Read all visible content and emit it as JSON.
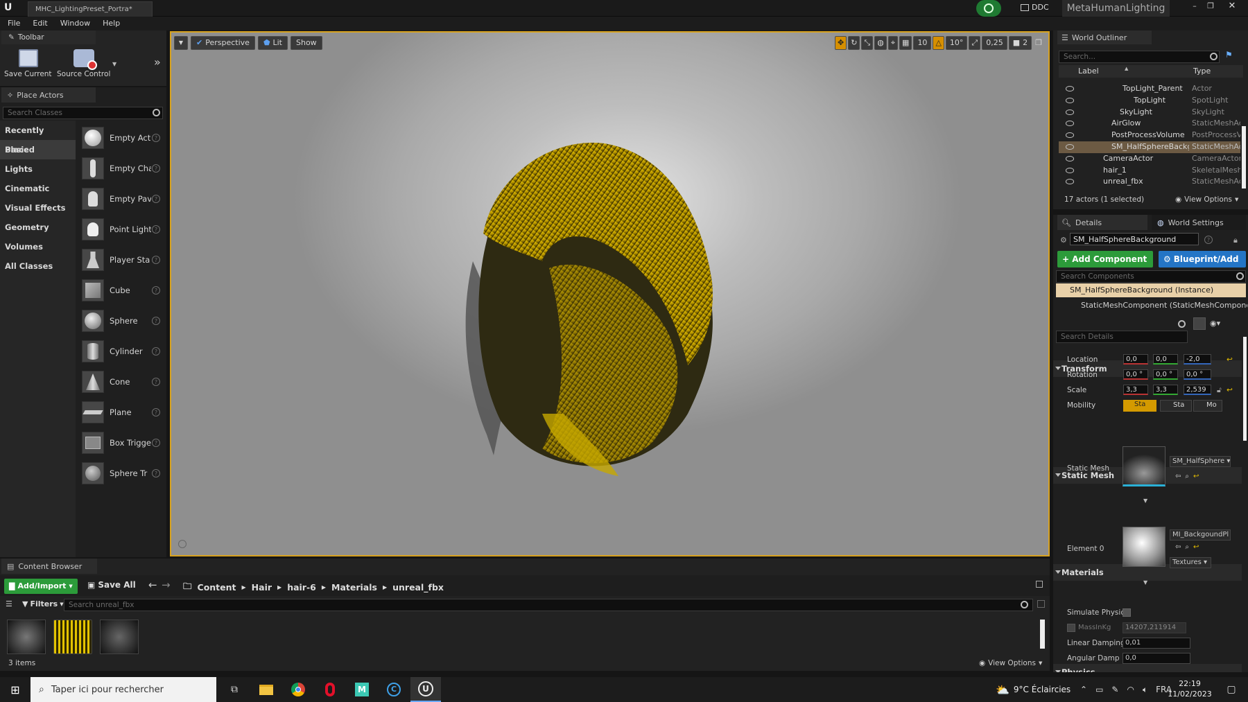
{
  "title_bar": {
    "tab": "MHC_LightingPreset_Portra*",
    "ddc": "DDC",
    "project": "MetaHumanLighting"
  },
  "menu": [
    "File",
    "Edit",
    "Window",
    "Help"
  ],
  "toolbar": {
    "title": "Toolbar",
    "save_current": "Save Current",
    "source_control": "Source Control"
  },
  "place_actors": {
    "title": "Place Actors",
    "search_placeholder": "Search Classes",
    "categories": [
      "Recently Placed",
      "Basic",
      "Lights",
      "Cinematic",
      "Visual Effects",
      "Geometry",
      "Volumes",
      "All Classes"
    ],
    "selected_category": "Basic",
    "items": [
      "Empty Act",
      "Empty Cha",
      "Empty Pav",
      "Point Light",
      "Player Sta",
      "Cube",
      "Sphere",
      "Cylinder",
      "Cone",
      "Plane",
      "Box Trigge",
      "Sphere Tr"
    ]
  },
  "viewport": {
    "perspective": "Perspective",
    "lit": "Lit",
    "show": "Show",
    "grid_snap": "10",
    "rot_snap": "10°",
    "scale_snap": "0,25",
    "cam_speed": "2"
  },
  "outliner": {
    "title": "World Outliner",
    "search_placeholder": "Search...",
    "col_label": "Label",
    "col_type": "Type",
    "rows": [
      {
        "name": "TopLight_Parent",
        "type": "Actor",
        "indent": 1
      },
      {
        "name": "TopLight",
        "type": "SpotLight",
        "indent": 2
      },
      {
        "name": "SkyLight",
        "type": "SkyLight",
        "indent": 1
      },
      {
        "name": "AirGlow",
        "type": "StaticMeshAc",
        "indent": 0
      },
      {
        "name": "PostProcessVolume",
        "type": "PostProcessV",
        "indent": 0
      },
      {
        "name": "SM_HalfSphereBackg",
        "type": "StaticMeshAc",
        "indent": 0,
        "selected": true
      },
      {
        "name": "CameraActor",
        "type": "CameraActor",
        "indent": -1
      },
      {
        "name": "hair_1",
        "type": "SkeletalMesh",
        "indent": -1
      },
      {
        "name": "unreal_fbx",
        "type": "StaticMeshAc",
        "indent": -1
      }
    ],
    "footer": "17 actors (1 selected)",
    "view_options": "View Options"
  },
  "details": {
    "tab_details": "Details",
    "tab_world": "World Settings",
    "object_name": "SM_HalfSphereBackground",
    "add_component": "+ Add Component",
    "blueprint": "Blueprint/Add",
    "search_components": "Search Components",
    "instance": "SM_HalfSphereBackground (Instance)",
    "component": "StaticMeshComponent (StaticMeshComponent",
    "search_details": "Search Details",
    "transform": {
      "title": "Transform",
      "location_label": "Location",
      "location": [
        "0,0",
        "0,0",
        "-2,0"
      ],
      "rotation_label": "Rotation",
      "rotation": [
        "0,0 °",
        "0,0 °",
        "0,0 °"
      ],
      "scale_label": "Scale",
      "scale": [
        "3,3",
        "3,3",
        "2,539"
      ],
      "mobility_label": "Mobility",
      "mobility": [
        "Sta",
        "Sta",
        "Mo"
      ]
    },
    "static_mesh": {
      "title": "Static Mesh",
      "label": "Static Mesh",
      "value": "SM_HalfSphere"
    },
    "materials": {
      "title": "Materials",
      "label": "Element 0",
      "value": "MI_BackgoundPl",
      "textures": "Textures"
    },
    "physics": {
      "title": "Physics",
      "simulate": "Simulate Physic",
      "mass_label": "MassInKg",
      "mass": "14207,211914",
      "linear_label": "Linear Damping",
      "linear": "0,01",
      "angular_label": "Angular Dampin",
      "angular": "0,0"
    }
  },
  "content_browser": {
    "title": "Content Browser",
    "add_import": "Add/Import",
    "save_all": "Save All",
    "path": [
      "Content",
      "Hair",
      "hair-6",
      "Materials",
      "unreal_fbx"
    ],
    "filters": "Filters",
    "search_placeholder": "Search unreal_fbx",
    "count": "3 items",
    "view_options": "View Options"
  },
  "taskbar": {
    "search_placeholder": "Taper ici pour rechercher",
    "weather": "9°C  Éclaircies",
    "lang": "FRA",
    "time": "22:19",
    "date": "11/02/2023"
  },
  "colors": {
    "accent_green": "#2c9b3a",
    "accent_blue": "#2475c6",
    "viewport_border": "#d7a21f",
    "selection": "#6c5a43",
    "hair_gold": "#e8c000"
  }
}
